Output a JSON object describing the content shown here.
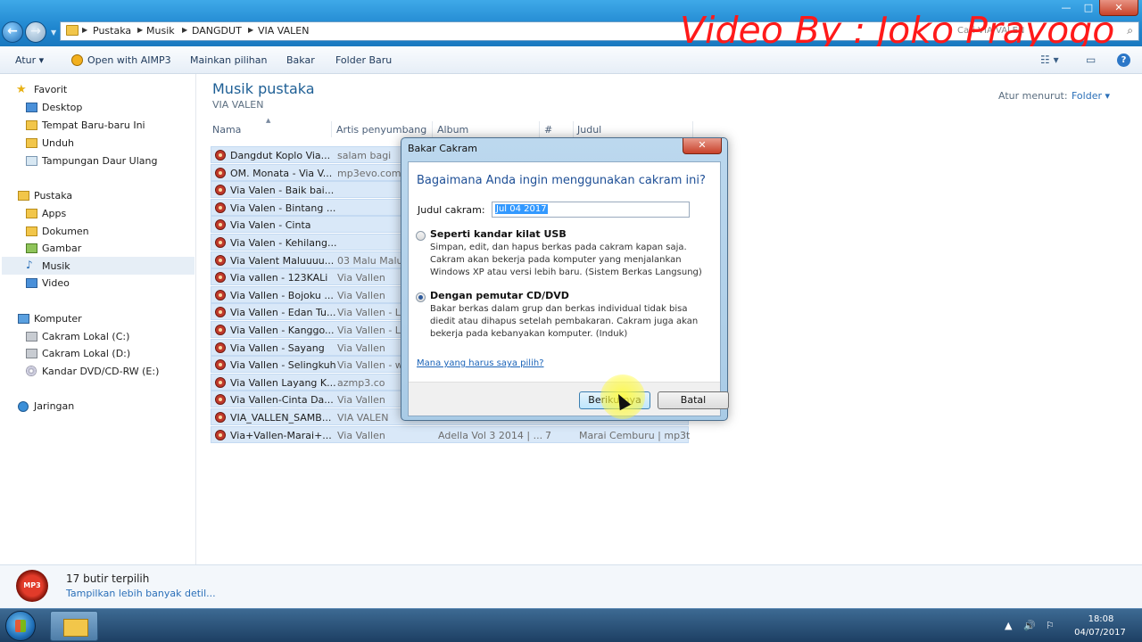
{
  "watermark": "Video By : Joko Prayogo",
  "addressbar": {
    "crumbs": [
      "Pustaka",
      "Musik",
      "DANGDUT",
      "VIA VALEN"
    ],
    "search_text": "Cari VIA VALEN"
  },
  "window_controls": {
    "minimize": "—",
    "maximize": "□",
    "close": "✕"
  },
  "toolbar": {
    "organize": "Atur ▾",
    "open_with": "Open with AIMP3",
    "play_selection": "Mainkan pilihan",
    "burn": "Bakar",
    "new_folder": "Folder Baru",
    "view_icon": "☷ ▾",
    "preview_icon": "▭",
    "help_icon": "?"
  },
  "sidebar": {
    "favorites": {
      "label": "Favorit",
      "items": [
        "Desktop",
        "Tempat Baru-baru Ini",
        "Unduh",
        "Tampungan Daur Ulang"
      ]
    },
    "libraries": {
      "label": "Pustaka",
      "items": [
        "Apps",
        "Dokumen",
        "Gambar",
        "Musik",
        "Video"
      ]
    },
    "computer": {
      "label": "Komputer",
      "items": [
        "Cakram Lokal (C:)",
        "Cakram Lokal (D:)",
        "Kandar DVD/CD-RW (E:)"
      ]
    },
    "network": {
      "label": "Jaringan"
    }
  },
  "main": {
    "title": "Musik pustaka",
    "subtitle": "VIA VALEN",
    "sort_label": "Atur menurut:",
    "sort_value": "Folder ▾",
    "columns": [
      "Nama",
      "Artis penyumbang",
      "Album",
      "#",
      "Judul"
    ],
    "rows": [
      {
        "name": "Dangdut Koplo  Via...",
        "artist": "salam bagi",
        "album": "",
        "num": "",
        "title": ""
      },
      {
        "name": "OM. Monata - Via V...",
        "artist": "mp3evo.com",
        "album": "",
        "num": "",
        "title": ""
      },
      {
        "name": "Via Valen - Baik bai...",
        "artist": "",
        "album": "",
        "num": "",
        "title": ""
      },
      {
        "name": "Via Valen - Bintang ...",
        "artist": "",
        "album": "",
        "num": "",
        "title": ""
      },
      {
        "name": "Via Valen - Cinta",
        "artist": "",
        "album": "",
        "num": "",
        "title": ""
      },
      {
        "name": "Via Valen - Kehilang...",
        "artist": "",
        "album": "",
        "num": "",
        "title": ""
      },
      {
        "name": "Via Valent Maluuuu...",
        "artist": "03 Malu Malu",
        "album": "",
        "num": "",
        "title": ""
      },
      {
        "name": "Via vallen - 123KALi",
        "artist": "Via Vallen",
        "album": "",
        "num": "",
        "title": ""
      },
      {
        "name": "Via Vallen - Bojoku ...",
        "artist": "Via Vallen",
        "album": "",
        "num": "",
        "title": ""
      },
      {
        "name": "Via Vallen - Edan Tu...",
        "artist": "Via Vallen - Lag",
        "album": "",
        "num": "",
        "title": ""
      },
      {
        "name": "Via Vallen - Kanggo...",
        "artist": "Via Vallen - Lag",
        "album": "",
        "num": "",
        "title": ""
      },
      {
        "name": "Via Vallen - Sayang",
        "artist": "Via Vallen",
        "album": "",
        "num": "",
        "title": ""
      },
      {
        "name": "Via Vallen - Selingkuh",
        "artist": "Via Vallen - ww",
        "album": "",
        "num": "",
        "title": ""
      },
      {
        "name": "Via Vallen Layang K...",
        "artist": "azmp3.co",
        "album": "",
        "num": "",
        "title": ""
      },
      {
        "name": "Via Vallen-Cinta Da...",
        "artist": "Via Vallen",
        "album": "",
        "num": "",
        "title": ""
      },
      {
        "name": "VIA_VALLEN_SAMB...",
        "artist": "VIA VALEN",
        "album": "",
        "num": "",
        "title": ""
      },
      {
        "name": "Via+Vallen-Marai+...",
        "artist": "Via Vallen",
        "album": "Adella Vol 3 2014 | ...",
        "num": "7",
        "title": "Marai Cemburu | mp3t..."
      }
    ]
  },
  "dialog": {
    "title": "Bakar Cakram",
    "close": "✕",
    "question": "Bagaimana Anda ingin menggunakan cakram ini?",
    "disc_title_label": "Judul cakram:",
    "disc_title_value": "Jul 04 2017",
    "option_usb": {
      "title": "Seperti kandar kilat USB",
      "desc": "Simpan, edit, dan hapus berkas pada cakram kapan saja. Cakram akan bekerja pada komputer yang menjalankan Windows XP atau versi lebih baru. (Sistem Berkas Langsung)",
      "selected": false
    },
    "option_cd": {
      "title": "Dengan pemutar CD/DVD",
      "desc": "Bakar berkas dalam grup dan berkas individual tidak bisa diedit atau dihapus setelah pembakaran. Cakram juga akan bekerja pada kebanyakan komputer. (Induk)",
      "selected": true
    },
    "help_link": "Mana yang harus saya pilih?",
    "next_button": "Berikutnya",
    "cancel_button": "Batal"
  },
  "details": {
    "icon_label": "MP3",
    "count": "17 butir terpilih",
    "more": "Tampilkan lebih banyak detil..."
  },
  "taskbar": {
    "time": "18:08",
    "date": "04/07/2017",
    "tray_icons": [
      "▲",
      "🔊",
      "⚐"
    ]
  }
}
